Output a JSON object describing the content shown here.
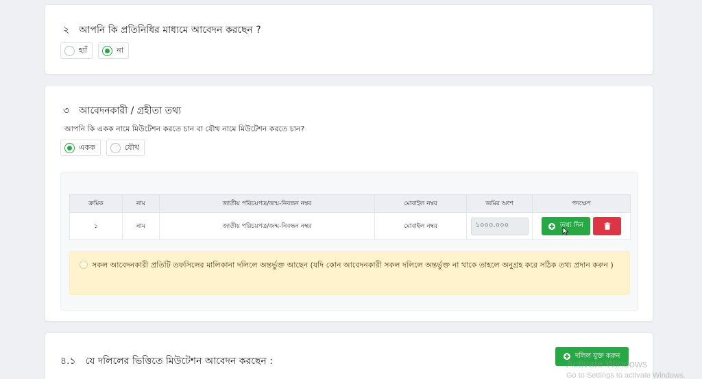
{
  "section2": {
    "number": "২",
    "question": "আপনি কি প্রতিনিধির মাধ্যমে আবেদন করছেন ?",
    "options": [
      {
        "label": "হ্যাঁ",
        "checked": false
      },
      {
        "label": "না",
        "checked": true
      }
    ]
  },
  "section3": {
    "number": "৩",
    "title": "আবেদনকারী / গ্রহীতা তথ্য",
    "question": "আপনি কি একক নামে মিউটেশন করতে চান বা যৌথ নামে মিউটেশন করতে চান?",
    "options": [
      {
        "label": "একক",
        "checked": true
      },
      {
        "label": "যৌথ",
        "checked": false
      }
    ],
    "table": {
      "headers": [
        "ক্রমিক",
        "নাম",
        "জাতীয় পরিচয়পত্র/জন্ম-নিবন্ধন নম্বর",
        "মোবাইল নম্বর",
        "জমির অংশ",
        "পদক্ষেপ"
      ],
      "row": {
        "serial": "১",
        "name": "নাম",
        "nid": "জাতীয় পরিচয়পত্র/জন্ম-নিবন্ধন নম্বর",
        "mobile": "মোবাইল নম্বর",
        "share": "১০০০.০০০"
      },
      "add_info_label": "তথ্য দিন"
    },
    "warning": "সকল আবেদনকারী প্রতিটি তফসিলের মালিকানা দলিলে অন্তর্ভুক্ত আছেন (যদি কোন আবেদনকারী সকল দলিলে অন্তর্ভুক্ত না থাকে তাহলে অনুগ্রহ করে সঠিক তথ্য প্রদান করুন )"
  },
  "section4": {
    "number": "৪.১",
    "question": "যে দলিলের ভিত্তিতে মিউটেশন আবেদন করছেন :",
    "add_deed_label": "দলিল যুক্ত করুন"
  },
  "watermark": {
    "line1": "Activate Windows",
    "line2": "Go to Settings to activate Windows."
  },
  "colors": {
    "accent_green": "#28a745",
    "danger_red": "#dc3545",
    "warning_bg": "#fff3cd"
  }
}
